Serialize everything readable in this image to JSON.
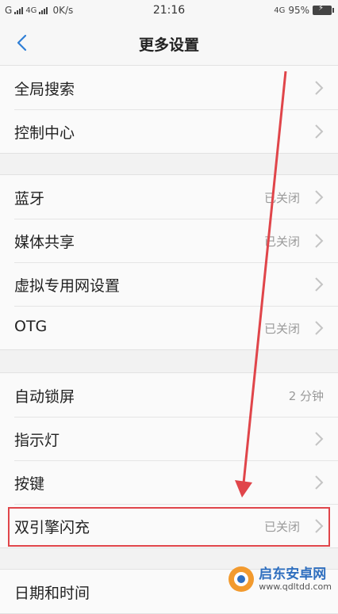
{
  "status_bar": {
    "carrier_left": "G",
    "network_type": "4G",
    "speed": "0K/s",
    "time": "21:16",
    "network_right": "4G",
    "battery_percent": "95%"
  },
  "header": {
    "title": "更多设置"
  },
  "groups": [
    {
      "items": [
        {
          "label": "全局搜索",
          "value": ""
        },
        {
          "label": "控制中心",
          "value": ""
        }
      ]
    },
    {
      "items": [
        {
          "label": "蓝牙",
          "value": "已关闭"
        },
        {
          "label": "媒体共享",
          "value": "已关闭"
        },
        {
          "label": "虚拟专用网设置",
          "value": ""
        },
        {
          "label": "OTG",
          "value": "已关闭"
        }
      ]
    },
    {
      "items": [
        {
          "label": "自动锁屏",
          "value": "2 分钟"
        },
        {
          "label": "指示灯",
          "value": ""
        },
        {
          "label": "按键",
          "value": ""
        },
        {
          "label": "双引擎闪充",
          "value": "已关闭"
        }
      ]
    },
    {
      "items": [
        {
          "label": "日期和时间",
          "value": ""
        }
      ]
    }
  ],
  "watermark": {
    "name": "启东安卓网",
    "url": "www.qdltdd.com"
  },
  "colors": {
    "highlight": "#e0454a",
    "back_arrow": "#2f7fd6"
  }
}
